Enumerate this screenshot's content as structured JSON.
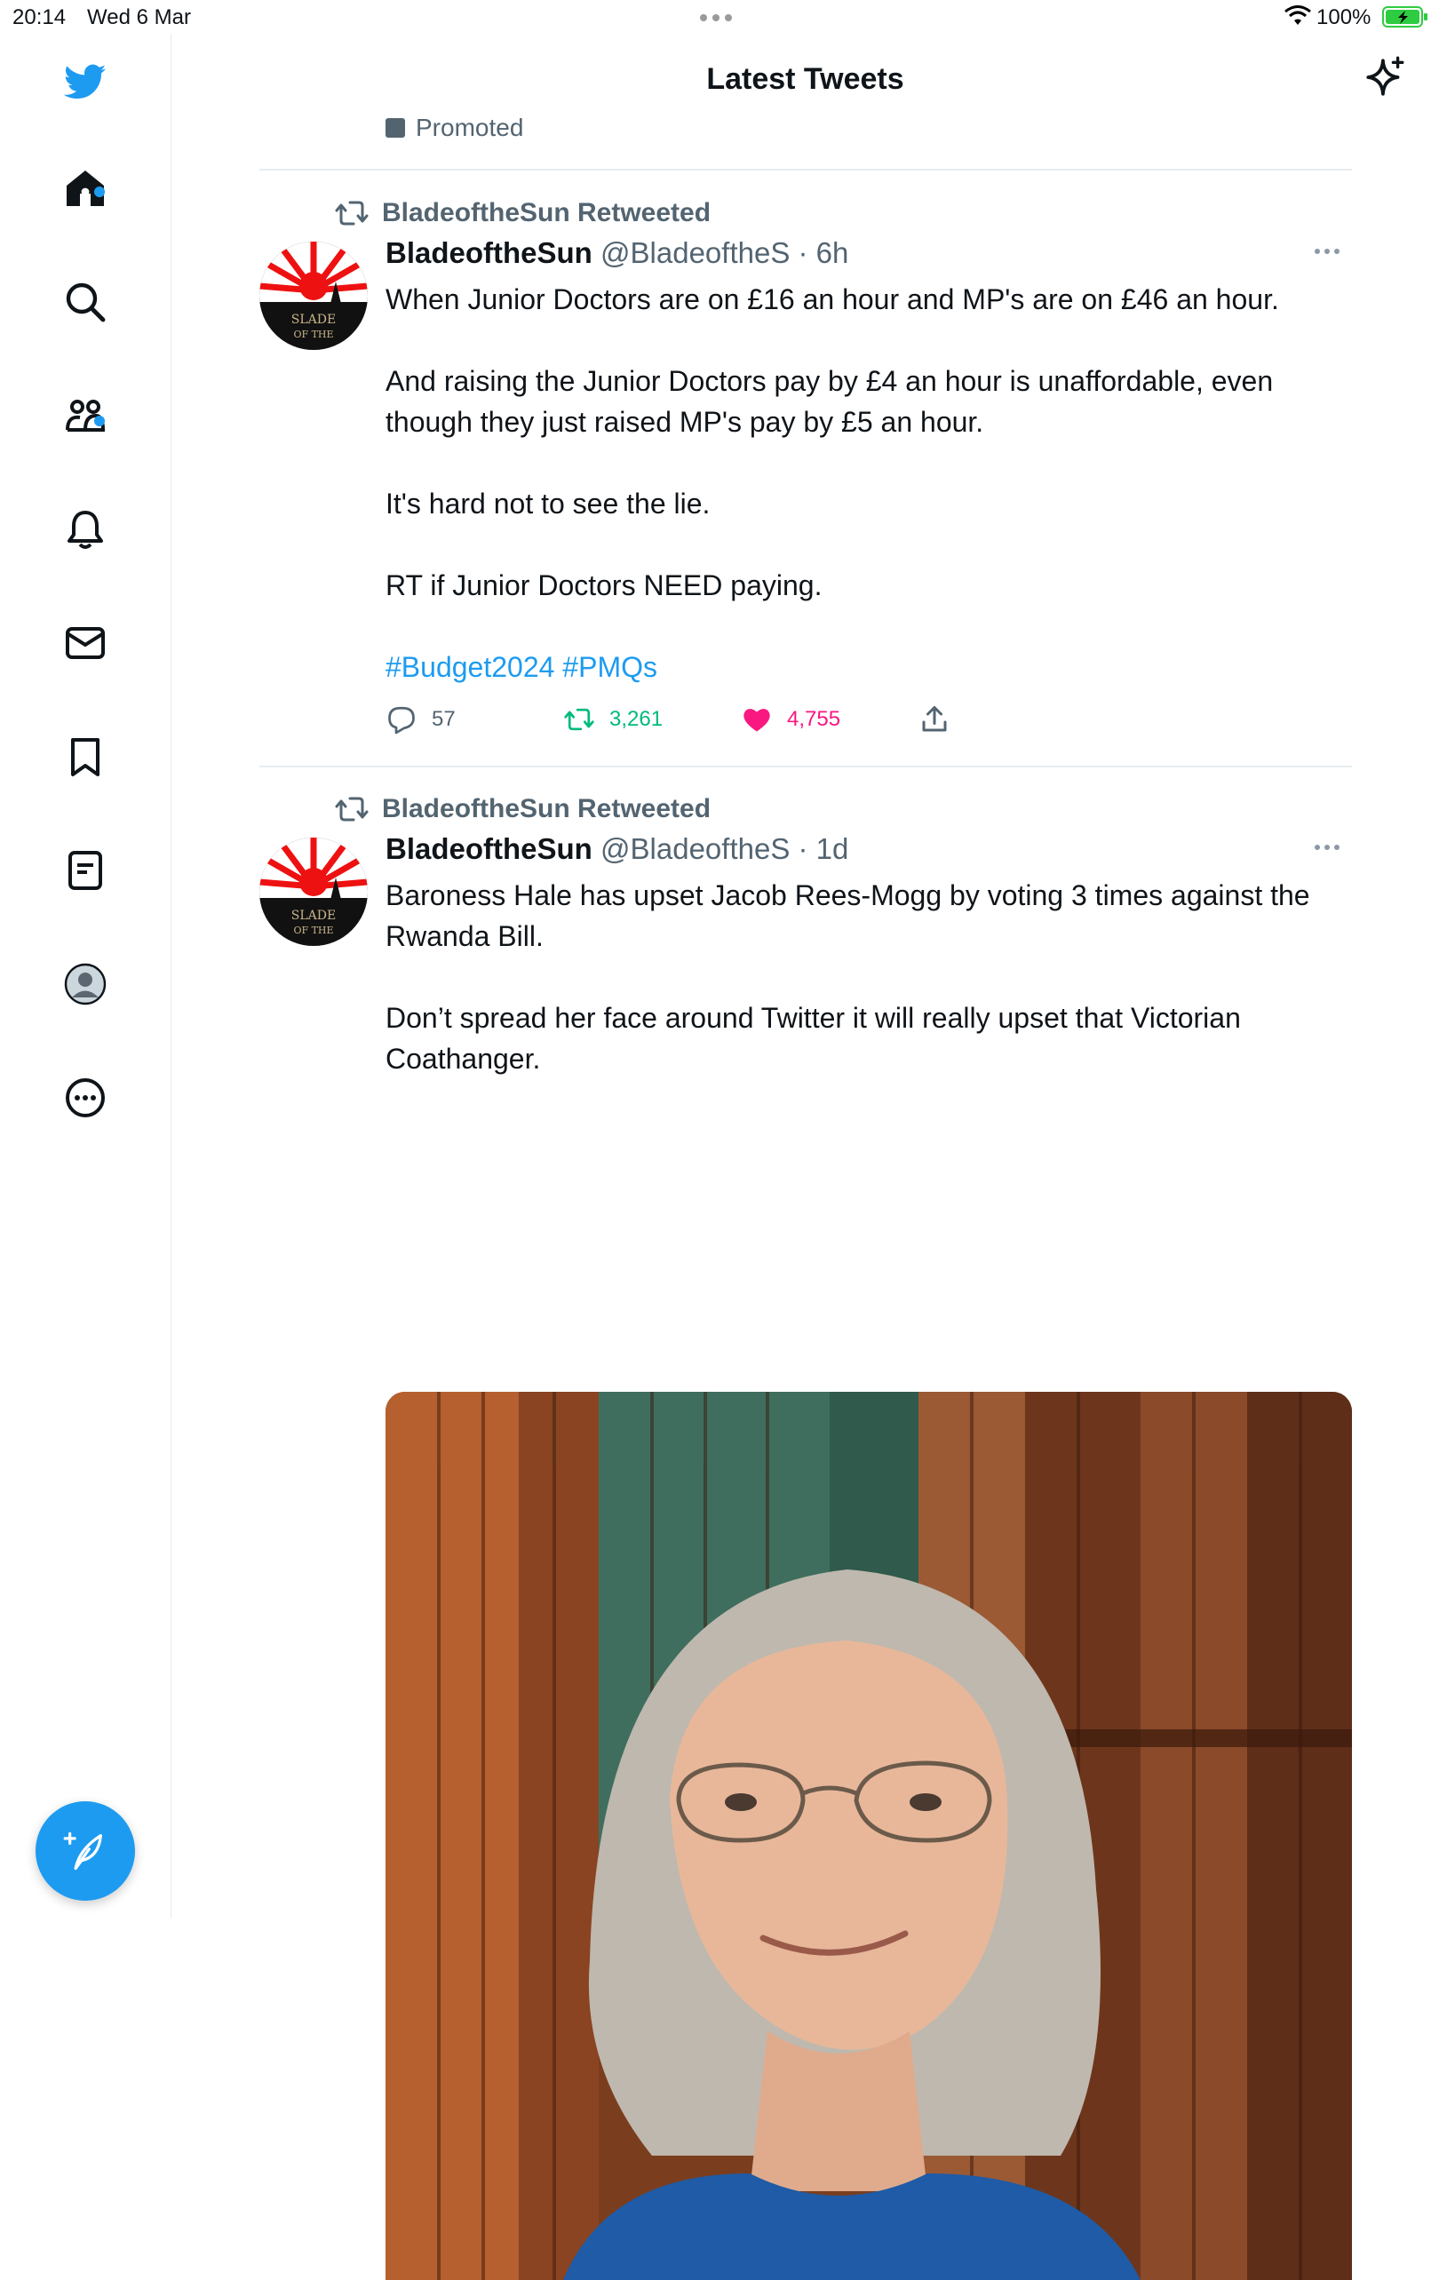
{
  "status_bar": {
    "time": "20:14",
    "date": "Wed 6 Mar",
    "battery": "100%"
  },
  "header": {
    "title": "Latest Tweets"
  },
  "promoted": {
    "label": "Promoted"
  },
  "tweets": [
    {
      "retweet_label": "BladeoftheSun Retweeted",
      "name": "BladeoftheSun",
      "handle": "@BladeoftheS",
      "time": "· 6h",
      "paragraphs": [
        "When Junior Doctors are on £16 an hour and MP's are on £46 an hour.",
        "And raising the Junior Doctors pay by £4 an hour is unaffordable, even though they just raised MP's pay by £5 an hour.",
        "It's hard not to see the lie.",
        "RT if Junior Doctors NEED paying."
      ],
      "hashtags": "#Budget2024 #PMQs",
      "replies": "57",
      "retweets": "3,261",
      "likes": "4,755"
    },
    {
      "retweet_label": "BladeoftheSun Retweeted",
      "name": "BladeoftheSun",
      "handle": "@BladeoftheS",
      "time": "· 1d",
      "paragraphs": [
        "Baroness Hale has upset Jacob Rees-Mogg by voting 3 times against the Rwanda Bill.",
        "Don’t spread her face around Twitter it will really upset that Victorian Coathanger."
      ]
    }
  ],
  "sidebar": {
    "icons": [
      "twitter-logo",
      "home-icon",
      "search-icon",
      "communities-icon",
      "notifications-icon",
      "messages-icon",
      "bookmarks-icon",
      "lists-icon",
      "profile-icon",
      "more-icon"
    ]
  },
  "colors": {
    "accent": "#1d9bf0",
    "retweet": "#00ba7c",
    "like": "#f91880",
    "muted": "#536471"
  }
}
